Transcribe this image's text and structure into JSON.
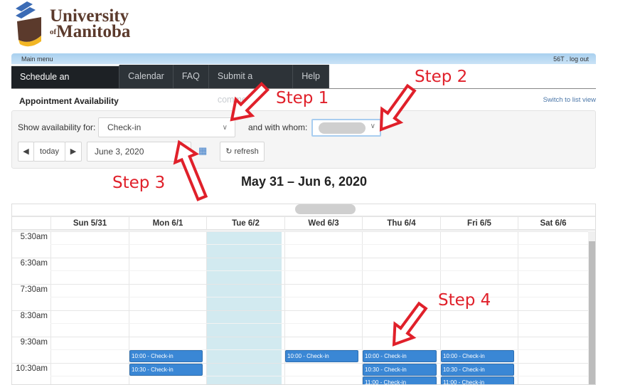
{
  "logo": {
    "line1": "University",
    "of": "of",
    "line2": "Manitoba"
  },
  "topbar": {
    "main_menu": "Main menu",
    "user": "56T . log out"
  },
  "nav": [
    {
      "label": "Schedule an appointment",
      "active": true
    },
    {
      "label": "Calendar"
    },
    {
      "label": "FAQ"
    },
    {
      "label": "Submit a comment"
    },
    {
      "label": "Help"
    }
  ],
  "section": {
    "title": "Appointment Availability",
    "switch_view": "Switch to list view"
  },
  "filters": {
    "show_label": "Show availability for:",
    "show_value": "Check-in",
    "whom_label": "and with whom:",
    "today": "today",
    "date": "June 3, 2020",
    "refresh": "refresh"
  },
  "calendar": {
    "heading": "May 31 – Jun 6, 2020",
    "days": [
      "Sun 5/31",
      "Mon 6/1",
      "Tue 6/2",
      "Wed 6/3",
      "Thu 6/4",
      "Fri 6/5",
      "Sat 6/6"
    ],
    "today_index": 2,
    "times": [
      "5:30am",
      "6:30am",
      "7:30am",
      "8:30am",
      "9:30am",
      "10:30am"
    ],
    "events": [
      {
        "day": 1,
        "start": "10:00",
        "label": "10:00 - Check-in"
      },
      {
        "day": 1,
        "start": "10:30",
        "label": "10:30 - Check-in"
      },
      {
        "day": 3,
        "start": "10:00",
        "label": "10:00 - Check-in"
      },
      {
        "day": 4,
        "start": "10:00",
        "label": "10:00 - Check-in"
      },
      {
        "day": 4,
        "start": "10:30",
        "label": "10:30 - Check-in"
      },
      {
        "day": 4,
        "start": "11:00",
        "label": "11:00 - Check-in"
      },
      {
        "day": 5,
        "start": "10:00",
        "label": "10:00 - Check-in"
      },
      {
        "day": 5,
        "start": "10:30",
        "label": "10:30 - Check-in"
      },
      {
        "day": 5,
        "start": "11:00",
        "label": "11:00 - Check-in"
      }
    ]
  },
  "annotations": {
    "step1": "Step 1",
    "step2": "Step 2",
    "step3": "Step 3",
    "step4": "Step 4",
    "color": "#e0202a"
  }
}
